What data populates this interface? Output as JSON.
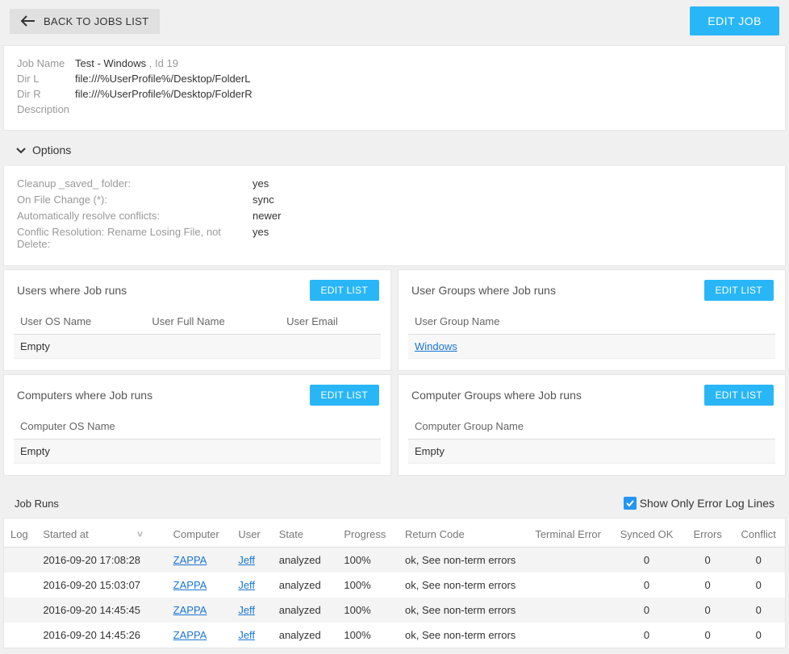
{
  "topbar": {
    "back": "BACK TO JOBS LIST",
    "edit": "EDIT JOB"
  },
  "job": {
    "labels": {
      "name": "Job Name",
      "dirL": "Dir L",
      "dirR": "Dir R",
      "desc": "Description",
      "id_label": ", Id"
    },
    "name": "Test - Windows",
    "id": "19",
    "dirL": "file:///%UserProfile%/Desktop/FolderL",
    "dirR": "file:///%UserProfile%/Desktop/FolderR",
    "description": ""
  },
  "options": {
    "title": "Options",
    "rows": [
      {
        "label": "Cleanup _saved_ folder:",
        "value": "yes"
      },
      {
        "label": "On File Change (*):",
        "value": "sync"
      },
      {
        "label": "Automatically resolve conflicts:",
        "value": "newer"
      },
      {
        "label": "Conflic Resolution: Rename Losing File, not Delete:",
        "value": "yes"
      }
    ]
  },
  "cards": {
    "users": {
      "title": "Users where Job runs",
      "edit": "EDIT LIST",
      "headers": [
        "User OS Name",
        "User Full Name",
        "User Email"
      ],
      "rows": [
        [
          "Empty",
          "",
          ""
        ]
      ]
    },
    "userGroups": {
      "title": "User Groups where Job runs",
      "edit": "EDIT LIST",
      "headers": [
        "User Group Name"
      ],
      "rows": [
        [
          "Windows"
        ]
      ],
      "rowLinks": [
        true
      ]
    },
    "computers": {
      "title": "Computers where Job runs",
      "edit": "EDIT LIST",
      "headers": [
        "Computer OS Name"
      ],
      "rows": [
        [
          "Empty"
        ]
      ]
    },
    "computerGroups": {
      "title": "Computer Groups where Job runs",
      "edit": "EDIT LIST",
      "headers": [
        "Computer Group Name"
      ],
      "rows": [
        [
          "Empty"
        ]
      ]
    }
  },
  "runs": {
    "title": "Job Runs",
    "checkbox_label": "Show Only Error Log Lines",
    "checkbox_checked": true,
    "headers": [
      "Log",
      "Started at",
      "Computer",
      "User",
      "State",
      "Progress",
      "Return Code",
      "Terminal Error",
      "Synced OK",
      "Errors",
      "Conflict"
    ],
    "rows": [
      {
        "log": "",
        "started": "2016-09-20 17:08:28",
        "computer": "ZAPPA",
        "user": "Jeff",
        "state": "analyzed",
        "progress": "100%",
        "rc": "ok, See non-term errors",
        "terr": "",
        "ok": "0",
        "err": "0",
        "conf": "0"
      },
      {
        "log": "",
        "started": "2016-09-20 15:03:07",
        "computer": "ZAPPA",
        "user": "Jeff",
        "state": "analyzed",
        "progress": "100%",
        "rc": "ok, See non-term errors",
        "terr": "",
        "ok": "0",
        "err": "0",
        "conf": "0"
      },
      {
        "log": "",
        "started": "2016-09-20 14:45:45",
        "computer": "ZAPPA",
        "user": "Jeff",
        "state": "analyzed",
        "progress": "100%",
        "rc": "ok, See non-term errors",
        "terr": "",
        "ok": "0",
        "err": "0",
        "conf": "0"
      },
      {
        "log": "",
        "started": "2016-09-20 14:45:26",
        "computer": "ZAPPA",
        "user": "Jeff",
        "state": "analyzed",
        "progress": "100%",
        "rc": "ok, See non-term errors",
        "terr": "",
        "ok": "0",
        "err": "0",
        "conf": "0"
      }
    ]
  }
}
